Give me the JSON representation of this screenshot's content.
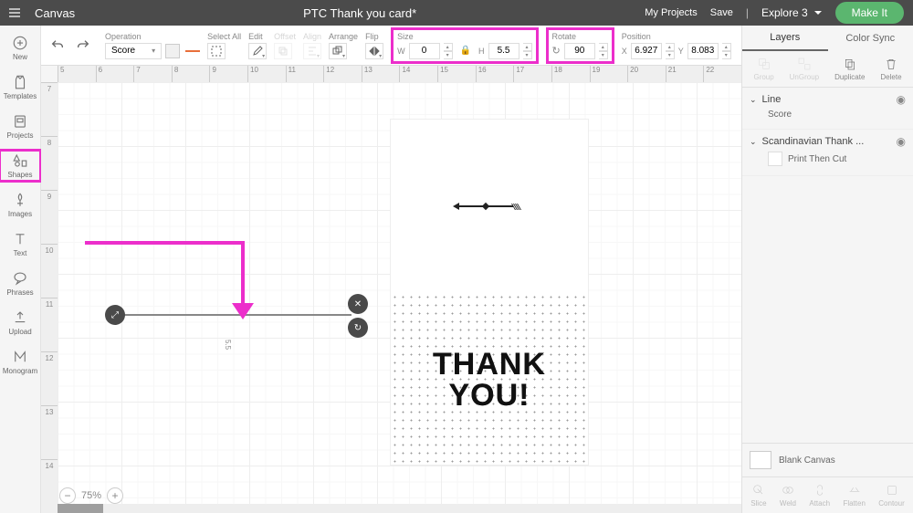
{
  "header": {
    "app": "Canvas",
    "doc": "PTC Thank you card*",
    "myProjects": "My Projects",
    "save": "Save",
    "machine": "Explore 3",
    "makeIt": "Make It"
  },
  "leftNav": {
    "new": "New",
    "templates": "Templates",
    "projects": "Projects",
    "shapes": "Shapes",
    "images": "Images",
    "text": "Text",
    "phrases": "Phrases",
    "upload": "Upload",
    "monogram": "Monogram"
  },
  "toolbar": {
    "operation": {
      "label": "Operation",
      "value": "Score"
    },
    "selectAll": "Select All",
    "edit": "Edit",
    "offset": "Offset",
    "align": "Align",
    "arrange": "Arrange",
    "flip": "Flip",
    "size": {
      "label": "Size",
      "wLabel": "W",
      "w": "0",
      "hLabel": "H",
      "h": "5.5"
    },
    "rotate": {
      "label": "Rotate",
      "value": "90"
    },
    "position": {
      "label": "Position",
      "xLabel": "X",
      "x": "6.927",
      "yLabel": "Y",
      "y": "8.083"
    }
  },
  "ruler": {
    "h": [
      "5",
      "6",
      "7",
      "8",
      "9",
      "10",
      "11",
      "12",
      "13",
      "14",
      "15",
      "16",
      "17",
      "18",
      "19",
      "20",
      "21",
      "22"
    ],
    "v": [
      "7",
      "8",
      "9",
      "10",
      "11",
      "12",
      "13",
      "14"
    ]
  },
  "selection": {
    "dim": "5.5"
  },
  "card": {
    "line1": "THANK",
    "line2": "YOU!"
  },
  "zoom": {
    "value": "75%"
  },
  "rightPanel": {
    "tabs": {
      "layers": "Layers",
      "colorSync": "Color Sync"
    },
    "tools": {
      "group": "Group",
      "ungroup": "UnGroup",
      "duplicate": "Duplicate",
      "delete": "Delete"
    },
    "layers": {
      "line": {
        "name": "Line",
        "child": "Score"
      },
      "scandi": {
        "name": "Scandinavian Thank ...",
        "child": "Print Then Cut"
      }
    },
    "blank": "Blank Canvas",
    "bottom": {
      "slice": "Slice",
      "weld": "Weld",
      "attach": "Attach",
      "flatten": "Flatten",
      "contour": "Contour"
    }
  }
}
